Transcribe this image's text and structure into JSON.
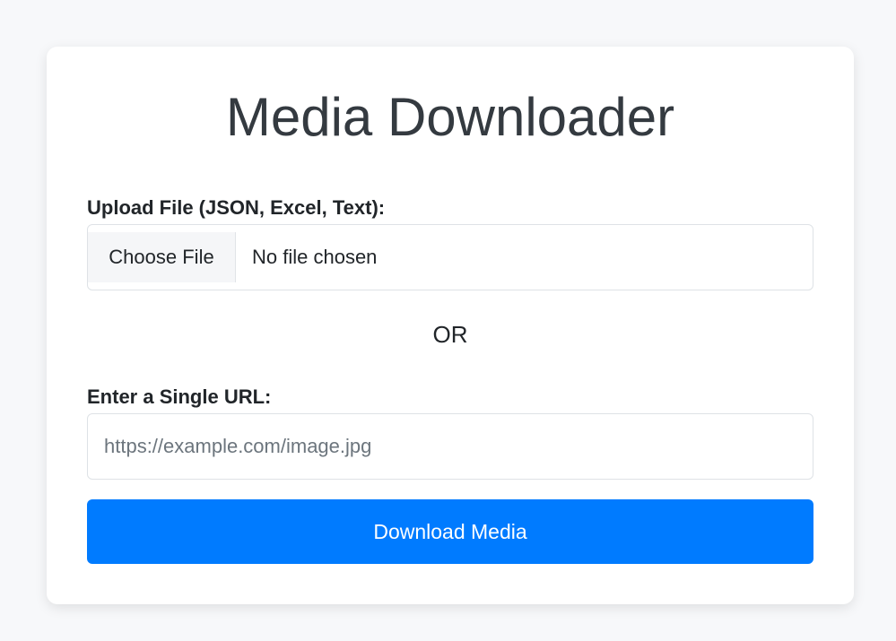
{
  "app": {
    "title": "Media Downloader"
  },
  "upload": {
    "label": "Upload File (JSON, Excel, Text):",
    "choose_button": "Choose File",
    "status": "No file chosen"
  },
  "separator": {
    "text": "OR"
  },
  "url": {
    "label": "Enter a Single URL:",
    "value": "",
    "placeholder": "https://example.com/image.jpg"
  },
  "actions": {
    "download_label": "Download Media"
  },
  "colors": {
    "primary": "#007bff",
    "background": "#f7f8fa",
    "card": "#ffffff",
    "title_text": "#343a40"
  }
}
